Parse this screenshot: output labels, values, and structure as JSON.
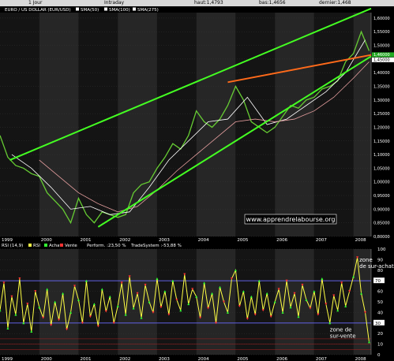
{
  "header": {
    "timeframe": "1 Jour",
    "mode": "Intraday",
    "high": "haut:1,4793",
    "low": "bas:1,4656",
    "last": "dernier:1,468"
  },
  "chart_data": [
    {
      "type": "line",
      "title": "EURO / US DOLLAR (EUR/USD)",
      "legend": [
        "SMA(50)",
        "SMA(100)",
        "SMA(275)"
      ],
      "legend_placement": "top-left",
      "x_tick_labels": [
        "1999",
        "2000",
        "2001",
        "2002",
        "2003",
        "2004",
        "2005",
        "2006",
        "2007",
        "2008"
      ],
      "xlim": [
        1999.0,
        2008.45
      ],
      "y_tick_labels": [
        "0,80000",
        "0,85000",
        "0,90000",
        "0,95000",
        "1,00000",
        "1,05000",
        "1,10000",
        "1,15000",
        "1,20000",
        "1,25000",
        "1,30000",
        "1,35000",
        "1,40000",
        "1,45000",
        "1,50000",
        "1,55000",
        "1,60000"
      ],
      "ylim": [
        0.8,
        1.62
      ],
      "last_price_labels": [
        "1,46000",
        "1,45000"
      ],
      "grid": true,
      "watermark": "www.apprendrelabourse.org",
      "series": [
        {
          "name": "EUR/USD",
          "color": "#66cc33",
          "x": [
            1999.0,
            1999.2,
            1999.4,
            1999.6,
            1999.8,
            2000.0,
            2000.2,
            2000.4,
            2000.6,
            2000.8,
            2001.0,
            2001.2,
            2001.4,
            2001.6,
            2001.8,
            2002.0,
            2002.2,
            2002.4,
            2002.6,
            2002.8,
            2003.0,
            2003.2,
            2003.4,
            2003.6,
            2003.8,
            2004.0,
            2004.2,
            2004.4,
            2004.6,
            2004.8,
            2005.0,
            2005.2,
            2005.4,
            2005.6,
            2005.8,
            2006.0,
            2006.2,
            2006.4,
            2006.6,
            2006.8,
            2007.0,
            2007.2,
            2007.4,
            2007.6,
            2007.8,
            2008.0,
            2008.2,
            2008.4
          ],
          "y": [
            1.17,
            1.09,
            1.06,
            1.05,
            1.03,
            1.02,
            0.96,
            0.93,
            0.9,
            0.85,
            0.94,
            0.88,
            0.85,
            0.89,
            0.88,
            0.87,
            0.88,
            0.96,
            0.99,
            1.0,
            1.05,
            1.09,
            1.14,
            1.12,
            1.17,
            1.26,
            1.22,
            1.2,
            1.23,
            1.28,
            1.35,
            1.3,
            1.22,
            1.2,
            1.18,
            1.2,
            1.24,
            1.28,
            1.27,
            1.3,
            1.31,
            1.34,
            1.35,
            1.37,
            1.44,
            1.47,
            1.55,
            1.48
          ]
        },
        {
          "name": "SMA(50)",
          "color": "#ffffff",
          "x": [
            1999.3,
            1999.8,
            2000.3,
            2000.8,
            2001.3,
            2001.8,
            2002.3,
            2002.8,
            2003.3,
            2003.8,
            2004.3,
            2004.8,
            2005.3,
            2005.8,
            2006.3,
            2006.8,
            2007.3,
            2007.8,
            2008.3
          ],
          "y": [
            1.1,
            1.05,
            0.98,
            0.9,
            0.91,
            0.88,
            0.89,
            0.98,
            1.08,
            1.15,
            1.22,
            1.23,
            1.31,
            1.21,
            1.23,
            1.28,
            1.33,
            1.4,
            1.52
          ]
        },
        {
          "name": "SMA(275)",
          "color": "#e8a0a0",
          "x": [
            2000.0,
            2000.5,
            2001.0,
            2001.5,
            2002.0,
            2002.5,
            2003.0,
            2003.5,
            2004.0,
            2004.5,
            2005.0,
            2005.5,
            2006.0,
            2006.5,
            2007.0,
            2007.5,
            2008.0,
            2008.4
          ],
          "y": [
            1.08,
            1.02,
            0.96,
            0.92,
            0.89,
            0.91,
            0.97,
            1.04,
            1.1,
            1.16,
            1.22,
            1.23,
            1.22,
            1.23,
            1.26,
            1.31,
            1.38,
            1.44
          ]
        }
      ],
      "trendlines": [
        {
          "color": "#44ff22",
          "from": [
            1999.25,
            1.08
          ],
          "to": [
            2008.45,
            1.635
          ]
        },
        {
          "color": "#44ff22",
          "from": [
            2001.5,
            0.835
          ],
          "to": [
            2008.45,
            1.46
          ]
        },
        {
          "color": "#ff6a1a",
          "from": [
            2004.8,
            1.365
          ],
          "to": [
            2008.45,
            1.465
          ]
        }
      ]
    },
    {
      "type": "line",
      "title": "RSI (14,9)",
      "legend": [
        "RSI",
        "Achat",
        "Vente",
        "Perform. :23,50 %",
        "TradeSystem :-53,88 %"
      ],
      "legend_placement": "top-left",
      "x_tick_labels": [
        "1999",
        "2000",
        "2001",
        "2002",
        "2003",
        "2004",
        "2005",
        "2006",
        "2007",
        "2008"
      ],
      "xlim": [
        1999.0,
        2008.45
      ],
      "y_tick_labels": [
        "0",
        "10",
        "20",
        "30",
        "40",
        "50",
        "60",
        "70",
        "80",
        "90",
        "100"
      ],
      "ylim": [
        0,
        100
      ],
      "reference_levels": [
        70,
        30
      ],
      "last_value_labels": [
        "70",
        "30"
      ],
      "annotations": [
        {
          "text_lines": [
            "zone",
            "de sur-achat"
          ],
          "x": 2008.15,
          "y": 88
        },
        {
          "text_lines": [
            "zone de",
            "sur-vente"
          ],
          "x": 2007.4,
          "y": 22
        }
      ],
      "series": [
        {
          "name": "RSI",
          "color": "#ffff44",
          "x": [
            1999.0,
            1999.1,
            1999.2,
            1999.3,
            1999.4,
            1999.5,
            1999.6,
            1999.7,
            1999.8,
            1999.9,
            2000.0,
            2000.1,
            2000.2,
            2000.3,
            2000.4,
            2000.5,
            2000.6,
            2000.7,
            2000.8,
            2000.9,
            2001.0,
            2001.1,
            2001.2,
            2001.3,
            2001.4,
            2001.5,
            2001.6,
            2001.7,
            2001.8,
            2001.9,
            2002.0,
            2002.1,
            2002.2,
            2002.3,
            2002.4,
            2002.5,
            2002.6,
            2002.7,
            2002.8,
            2002.9,
            2003.0,
            2003.1,
            2003.2,
            2003.3,
            2003.4,
            2003.5,
            2003.6,
            2003.7,
            2003.8,
            2003.9,
            2004.0,
            2004.1,
            2004.2,
            2004.3,
            2004.4,
            2004.5,
            2004.6,
            2004.7,
            2004.8,
            2004.9,
            2005.0,
            2005.1,
            2005.2,
            2005.3,
            2005.4,
            2005.5,
            2005.6,
            2005.7,
            2005.8,
            2005.9,
            2006.0,
            2006.1,
            2006.2,
            2006.3,
            2006.4,
            2006.5,
            2006.6,
            2006.7,
            2006.8,
            2006.9,
            2007.0,
            2007.1,
            2007.2,
            2007.3,
            2007.4,
            2007.5,
            2007.6,
            2007.7,
            2007.8,
            2007.9,
            2008.0,
            2008.1,
            2008.2,
            2008.3,
            2008.4
          ],
          "y": [
            42,
            68,
            25,
            55,
            38,
            72,
            30,
            48,
            22,
            60,
            45,
            35,
            62,
            28,
            50,
            33,
            58,
            24,
            40,
            65,
            52,
            30,
            70,
            36,
            48,
            27,
            62,
            41,
            55,
            30,
            46,
            68,
            38,
            74,
            44,
            58,
            35,
            66,
            50,
            40,
            72,
            45,
            60,
            38,
            70,
            52,
            42,
            76,
            48,
            62,
            55,
            35,
            68,
            44,
            58,
            30,
            64,
            50,
            40,
            72,
            80,
            46,
            60,
            34,
            55,
            38,
            70,
            42,
            58,
            36,
            50,
            62,
            40,
            70,
            45,
            58,
            36,
            66,
            52,
            44,
            60,
            38,
            72,
            48,
            30,
            56,
            42,
            68,
            46,
            60,
            74,
            92,
            58,
            40,
            12
          ]
        },
        {
          "name": "Achat",
          "color": "#33ff33",
          "marker": "triangle-up"
        },
        {
          "name": "Vente",
          "color": "#ff3333",
          "marker": "triangle-down"
        }
      ]
    }
  ]
}
